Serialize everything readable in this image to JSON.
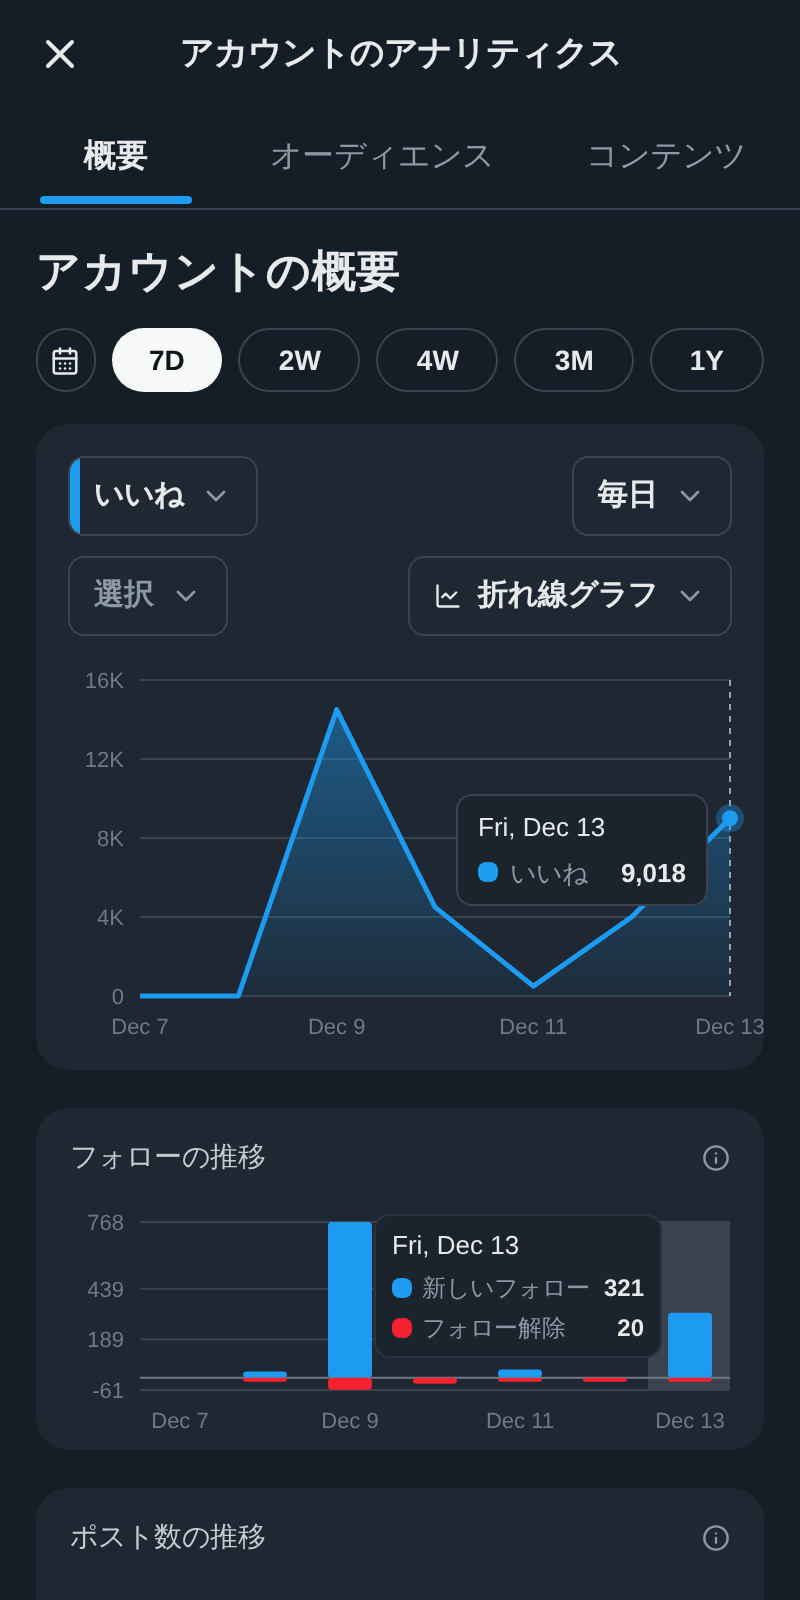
{
  "header": {
    "title": "アカウントのアナリティクス"
  },
  "tabs": [
    {
      "label": "概要",
      "selected": true
    },
    {
      "label": "オーディエンス",
      "selected": false
    },
    {
      "label": "コンテンツ",
      "selected": false
    }
  ],
  "section_title": "アカウントの概要",
  "periods": [
    {
      "label": "7D",
      "selected": true
    },
    {
      "label": "2W",
      "selected": false
    },
    {
      "label": "4W",
      "selected": false
    },
    {
      "label": "3M",
      "selected": false
    },
    {
      "label": "1Y",
      "selected": false
    }
  ],
  "main_card": {
    "metric_select": "いいね",
    "interval_select": "毎日",
    "compare_select": "選択",
    "chart_type_select": "折れ線グラフ",
    "tooltip": {
      "date": "Fri, Dec 13",
      "value": "9,018"
    },
    "chart_data": {
      "type": "area",
      "grid": true,
      "categories": [
        "Dec 7",
        null,
        "Dec 9",
        null,
        "Dec 11",
        null,
        "Dec 13"
      ],
      "ylim": [
        0,
        16000
      ],
      "yticks": [
        {
          "value": 0,
          "label": "0"
        },
        {
          "value": 4000,
          "label": "4K"
        },
        {
          "value": 8000,
          "label": "8K"
        },
        {
          "value": 12000,
          "label": "12K"
        },
        {
          "value": 16000,
          "label": "16K"
        }
      ],
      "series": [
        {
          "name": "いいね",
          "color": "#1d9bf0",
          "values": [
            0,
            0,
            14500,
            4500,
            500,
            4000,
            9000
          ]
        }
      ]
    }
  },
  "follow_card": {
    "title": "フォローの推移",
    "tooltip": {
      "date": "Fri, Dec 13",
      "values": [
        "321",
        "20"
      ]
    },
    "chart_data": {
      "type": "bar",
      "stacked": true,
      "grid": true,
      "categories": [
        "Dec 7",
        null,
        "Dec 9",
        null,
        "Dec 11",
        null,
        "Dec 13"
      ],
      "ylim": [
        -61,
        768
      ],
      "yticks": [
        -61,
        189,
        439,
        768
      ],
      "series": [
        {
          "name": "新しいフォロー",
          "color": "#1d9bf0",
          "values": [
            0,
            30,
            768,
            null,
            40,
            null,
            320
          ]
        },
        {
          "name": "フォロー解除",
          "color": "#f4212e",
          "values": [
            0,
            -20,
            -60,
            -30,
            -20,
            -20,
            -20
          ]
        }
      ]
    }
  },
  "posts_card": {
    "title": "ポスト数の推移"
  }
}
